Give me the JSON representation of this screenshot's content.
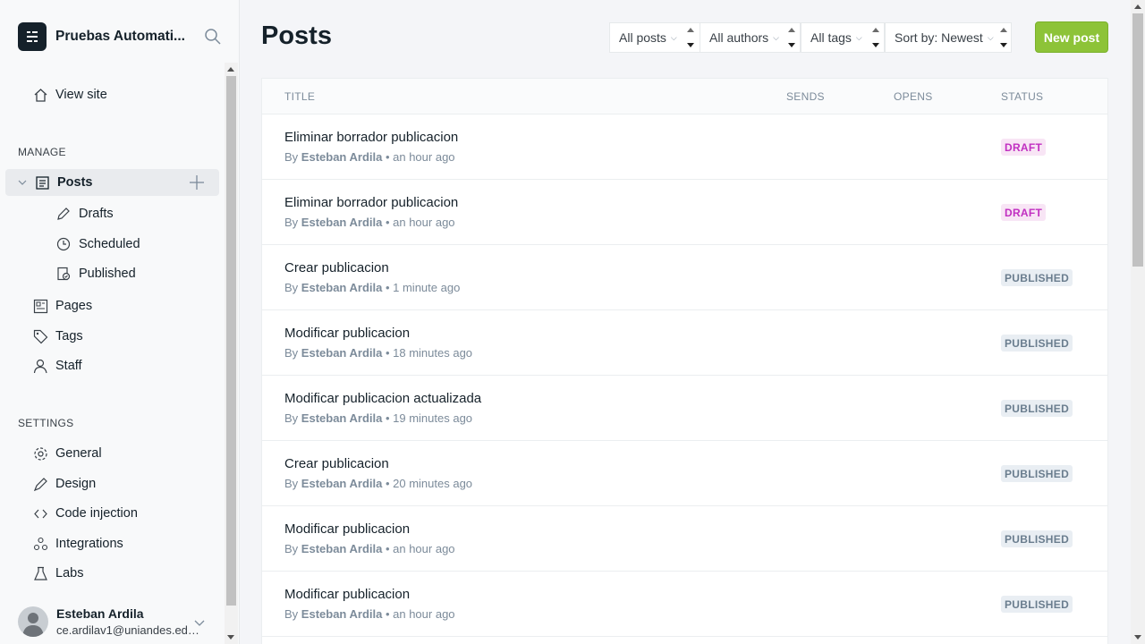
{
  "sidebar": {
    "site_title": "Pruebas Automati...",
    "view_site": "View site",
    "manage_label": "MANAGE",
    "posts": "Posts",
    "drafts": "Drafts",
    "scheduled": "Scheduled",
    "published": "Published",
    "pages": "Pages",
    "tags": "Tags",
    "staff": "Staff",
    "settings_label": "SETTINGS",
    "general": "General",
    "design": "Design",
    "code_injection": "Code injection",
    "integrations": "Integrations",
    "labs": "Labs",
    "user_name": "Esteban Ardila",
    "user_email": "ce.ardilav1@uniandes.edu..."
  },
  "header": {
    "title": "Posts",
    "filter_posts": "All posts",
    "filter_authors": "All authors",
    "filter_tags": "All tags",
    "sort": "Sort by: Newest",
    "new_post": "New post"
  },
  "table": {
    "headers": {
      "title": "TITLE",
      "sends": "SENDS",
      "opens": "OPENS",
      "status": "STATUS"
    },
    "rows": [
      {
        "title": "Eliminar borrador publicacion",
        "by": "By",
        "author": "Esteban Ardila",
        "time": "• an hour ago",
        "status": "DRAFT"
      },
      {
        "title": "Eliminar borrador publicacion",
        "by": "By",
        "author": "Esteban Ardila",
        "time": "• an hour ago",
        "status": "DRAFT"
      },
      {
        "title": "Crear publicacion",
        "by": "By",
        "author": "Esteban Ardila",
        "time": "• 1 minute ago",
        "status": "PUBLISHED"
      },
      {
        "title": "Modificar publicacion",
        "by": "By",
        "author": "Esteban Ardila",
        "time": "• 18 minutes ago",
        "status": "PUBLISHED"
      },
      {
        "title": "Modificar publicacion actualizada",
        "by": "By",
        "author": "Esteban Ardila",
        "time": "• 19 minutes ago",
        "status": "PUBLISHED"
      },
      {
        "title": "Crear publicacion",
        "by": "By",
        "author": "Esteban Ardila",
        "time": "• 20 minutes ago",
        "status": "PUBLISHED"
      },
      {
        "title": "Modificar publicacion",
        "by": "By",
        "author": "Esteban Ardila",
        "time": "• an hour ago",
        "status": "PUBLISHED"
      },
      {
        "title": "Modificar publicacion",
        "by": "By",
        "author": "Esteban Ardila",
        "time": "• an hour ago",
        "status": "PUBLISHED"
      }
    ]
  }
}
